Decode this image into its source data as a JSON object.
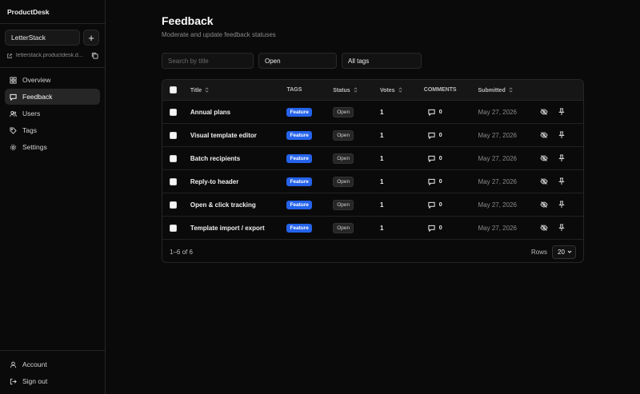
{
  "app": {
    "name": "ProductDesk"
  },
  "project": {
    "name": "LetterStack",
    "url": "letterstack.productdesk.d..."
  },
  "nav": {
    "items": [
      {
        "label": "Overview",
        "icon": "grid-icon"
      },
      {
        "label": "Feedback",
        "icon": "message-icon",
        "active": true
      },
      {
        "label": "Users",
        "icon": "users-icon"
      },
      {
        "label": "Tags",
        "icon": "tag-icon"
      },
      {
        "label": "Settings",
        "icon": "gear-icon"
      }
    ],
    "bottom": [
      {
        "label": "Account",
        "icon": "user-icon"
      },
      {
        "label": "Sign out",
        "icon": "sign-out-icon"
      }
    ]
  },
  "page": {
    "title": "Feedback",
    "subtitle": "Moderate and update feedback statuses"
  },
  "filters": {
    "search_placeholder": "Search by title",
    "status_value": "Open",
    "tags_value": "All tags"
  },
  "table": {
    "headers": {
      "title": "Title",
      "tags": "TAGS",
      "status": "Status",
      "votes": "Votes",
      "comments": "COMMENTS",
      "submitted": "Submitted"
    },
    "rows": [
      {
        "title": "Annual plans",
        "tag": "Feature",
        "status": "Open",
        "votes": "1",
        "comments": "0",
        "submitted": "May 27, 2026"
      },
      {
        "title": "Visual template editor",
        "tag": "Feature",
        "status": "Open",
        "votes": "1",
        "comments": "0",
        "submitted": "May 27, 2026"
      },
      {
        "title": "Batch recipients",
        "tag": "Feature",
        "status": "Open",
        "votes": "1",
        "comments": "0",
        "submitted": "May 27, 2026"
      },
      {
        "title": "Reply-to header",
        "tag": "Feature",
        "status": "Open",
        "votes": "1",
        "comments": "0",
        "submitted": "May 27, 2026"
      },
      {
        "title": "Open & click tracking",
        "tag": "Feature",
        "status": "Open",
        "votes": "1",
        "comments": "0",
        "submitted": "May 27, 2026"
      },
      {
        "title": "Template import / export",
        "tag": "Feature",
        "status": "Open",
        "votes": "1",
        "comments": "0",
        "submitted": "May 27, 2026"
      }
    ],
    "footer": {
      "range": "1–6 of 6",
      "rows_label": "Rows",
      "rows_value": "20"
    }
  },
  "colors": {
    "accent": "#2563eb",
    "background": "#0a0a0a",
    "border": "#262626"
  }
}
